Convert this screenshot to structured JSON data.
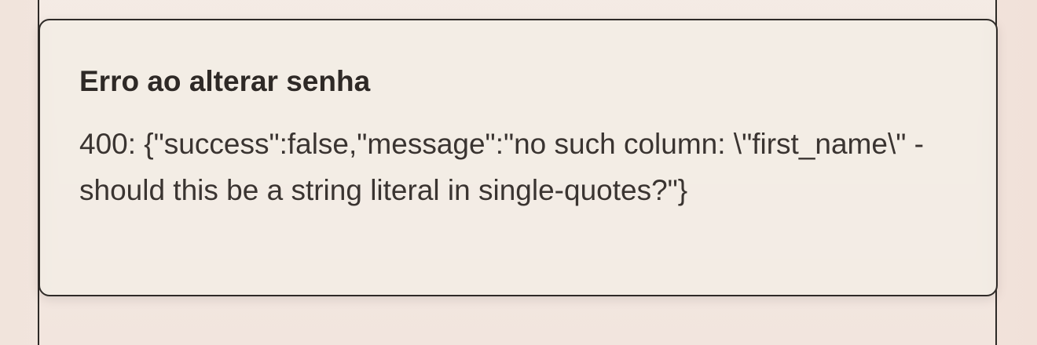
{
  "toast": {
    "title": "Erro ao alterar senha",
    "message": "400: {\"success\":false,\"message\":\"no such column: \\\"first_name\\\" - should this be a string literal in single-quotes?\"}"
  },
  "icons": {
    "ornament": "ornament-flourish-icon"
  },
  "colors": {
    "border": "#2e2a27",
    "ornament": "#c98a3c",
    "toast_background": "#f3ede5"
  }
}
